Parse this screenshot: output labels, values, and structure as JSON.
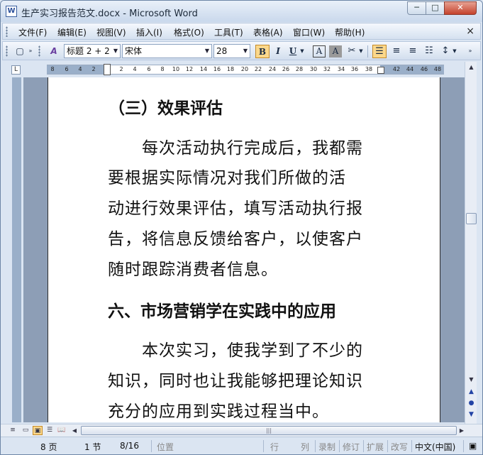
{
  "window": {
    "title": "生产实习报告范文.docx - Microsoft Word",
    "min_label": "─",
    "max_label": "□",
    "close_label": "✕"
  },
  "menu": {
    "items": [
      "文件(F)",
      "编辑(E)",
      "视图(V)",
      "插入(I)",
      "格式(O)",
      "工具(T)",
      "表格(A)",
      "窗口(W)",
      "帮助(H)"
    ],
    "close_doc": "×"
  },
  "toolbar": {
    "style": "标题 2 + 2",
    "font": "宋体",
    "size": "28",
    "bold": "B",
    "italic": "I",
    "underline": "U",
    "border_a": "A",
    "shade_a": "A"
  },
  "ruler": {
    "numbers": [
      "8",
      "6",
      "4",
      "2",
      "2",
      "4",
      "6",
      "8",
      "10",
      "12",
      "14",
      "16",
      "18",
      "20",
      "22",
      "24",
      "26",
      "28",
      "30",
      "32",
      "34",
      "36",
      "38",
      "42",
      "44",
      "46",
      "48"
    ]
  },
  "document": {
    "heading1": "（三）效果评估",
    "para1": [
      "每次活动执行完成后，我都需",
      "要根据实际情况对我们所做的活",
      "动进行效果评估，填写活动执行报",
      "告，将信息反馈给客户，以使客户",
      "随时跟踪消费者信息。"
    ],
    "heading2": "六、市场营销学在实践中的应用",
    "para2": [
      "本次实习，使我学到了不少的",
      "知识，同时也让我能够把理论知识",
      "充分的应用到实践过程当中。"
    ]
  },
  "status": {
    "page": "8 页",
    "section": "1 节",
    "page_of": "8/16",
    "position": "位置",
    "line": "行",
    "col": "列",
    "rec": "录制",
    "trk": "修订",
    "ext": "扩展",
    "ovr": "改写",
    "lang": "中文(中国)"
  },
  "colors": {
    "accent_active": "#fbd88b",
    "page_bg": "#ffffff",
    "workspace": "#8d9eb6"
  }
}
